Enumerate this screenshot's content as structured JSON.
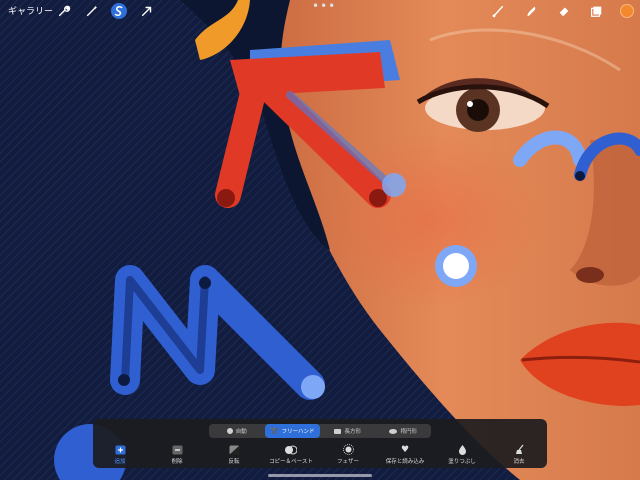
{
  "toolbar": {
    "gallery_label": "ギャラリー",
    "more_label": "•••",
    "left_tools": [
      "wrench-icon",
      "magic-wand-icon",
      "selection-icon",
      "transform-arrow-icon"
    ],
    "right_tools": [
      "brush-icon",
      "smudge-icon",
      "eraser-icon",
      "layers-icon"
    ],
    "current_color": "#f3892c"
  },
  "selection_panel": {
    "modes": [
      {
        "label": "自動",
        "active": false
      },
      {
        "label": "フリーハンド",
        "active": true
      },
      {
        "label": "長方形",
        "active": false
      },
      {
        "label": "楕円形",
        "active": false
      }
    ],
    "actions": [
      {
        "label": "追加",
        "active": true
      },
      {
        "label": "削除",
        "active": false
      },
      {
        "label": "反転",
        "active": false
      },
      {
        "label": "コピー＆ペースト",
        "active": false
      },
      {
        "label": "フェザー",
        "active": false
      },
      {
        "label": "保存と読み込み",
        "active": false
      },
      {
        "label": "塗りつぶし",
        "active": false
      },
      {
        "label": "消去",
        "active": false
      }
    ]
  },
  "colors": {
    "accent": "#2f6fd9",
    "panel": "#1c1c1e",
    "background": "#101a3a",
    "skin": "#d9784a",
    "red_marker": "#e03a26",
    "blue_marker": "#2f5fd0"
  }
}
